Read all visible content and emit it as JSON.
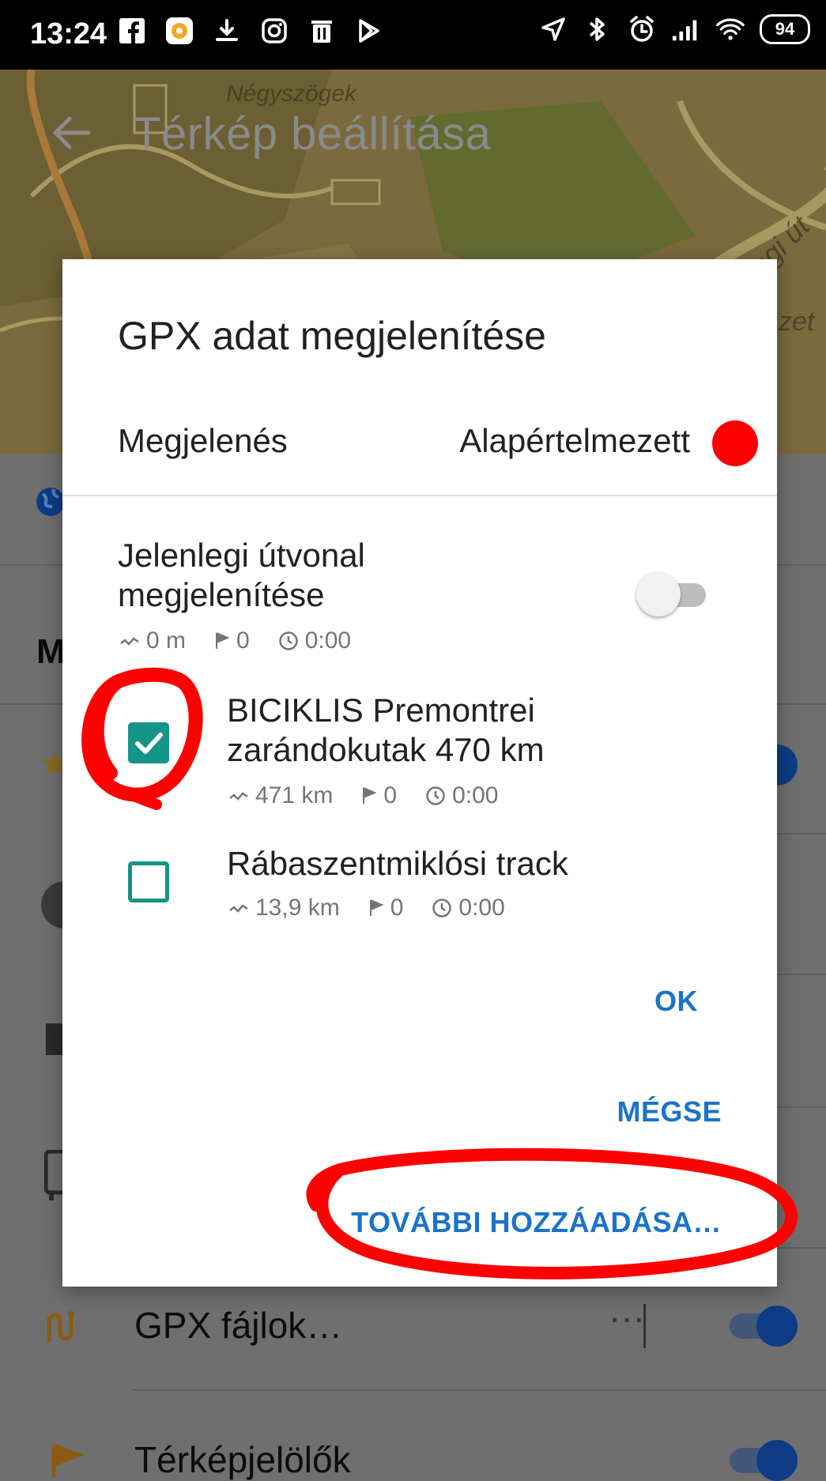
{
  "status_bar": {
    "time": "13:24",
    "battery": "94",
    "left_icons": [
      "facebook-icon",
      "app-icon",
      "download-icon",
      "instagram-icon",
      "trash-icon",
      "play-store-icon"
    ],
    "right_icons": [
      "location-icon",
      "bluetooth-icon",
      "alarm-icon",
      "signal-icon",
      "wifi-icon"
    ]
  },
  "app_bar": {
    "title": "Térkép beállítása",
    "map_labels": [
      "Négyszögek",
      "ümegi út",
      "zet"
    ]
  },
  "background_list": {
    "section_letter": "M",
    "gpx_files_label": "GPX fájlok…",
    "gpx_files_more": "···",
    "map_markers_label": "Térképjelölők"
  },
  "dialog": {
    "title": "GPX adat megjelenítése",
    "appearance_label": "Megjelenés",
    "appearance_value": "Alapértelmezett",
    "appearance_color": "#ff0000",
    "items": [
      {
        "title_line1": "Jelenlegi útvonal",
        "title_line2": "megjelenítése",
        "distance": "0 m",
        "waypoints": "0",
        "duration": "0:00",
        "control": "toggle",
        "checked": false
      },
      {
        "title_line1": "BICIKLIS Premontrei",
        "title_line2": "zarándokutak 470 km",
        "distance": "471 km",
        "waypoints": "0",
        "duration": "0:00",
        "control": "checkbox",
        "checked": true
      },
      {
        "title_line1": "Rábaszentmiklósi track",
        "title_line2": "",
        "distance": "13,9 km",
        "waypoints": "0",
        "duration": "0:00",
        "control": "checkbox",
        "checked": false
      }
    ],
    "ok_label": "OK",
    "cancel_label": "MÉGSE",
    "add_more_label": "TOVÁBBI HOZZÁADÁSA…"
  },
  "colors": {
    "accent": "#1a73c9",
    "checkbox": "#159488",
    "annotation": "#ff0000"
  }
}
